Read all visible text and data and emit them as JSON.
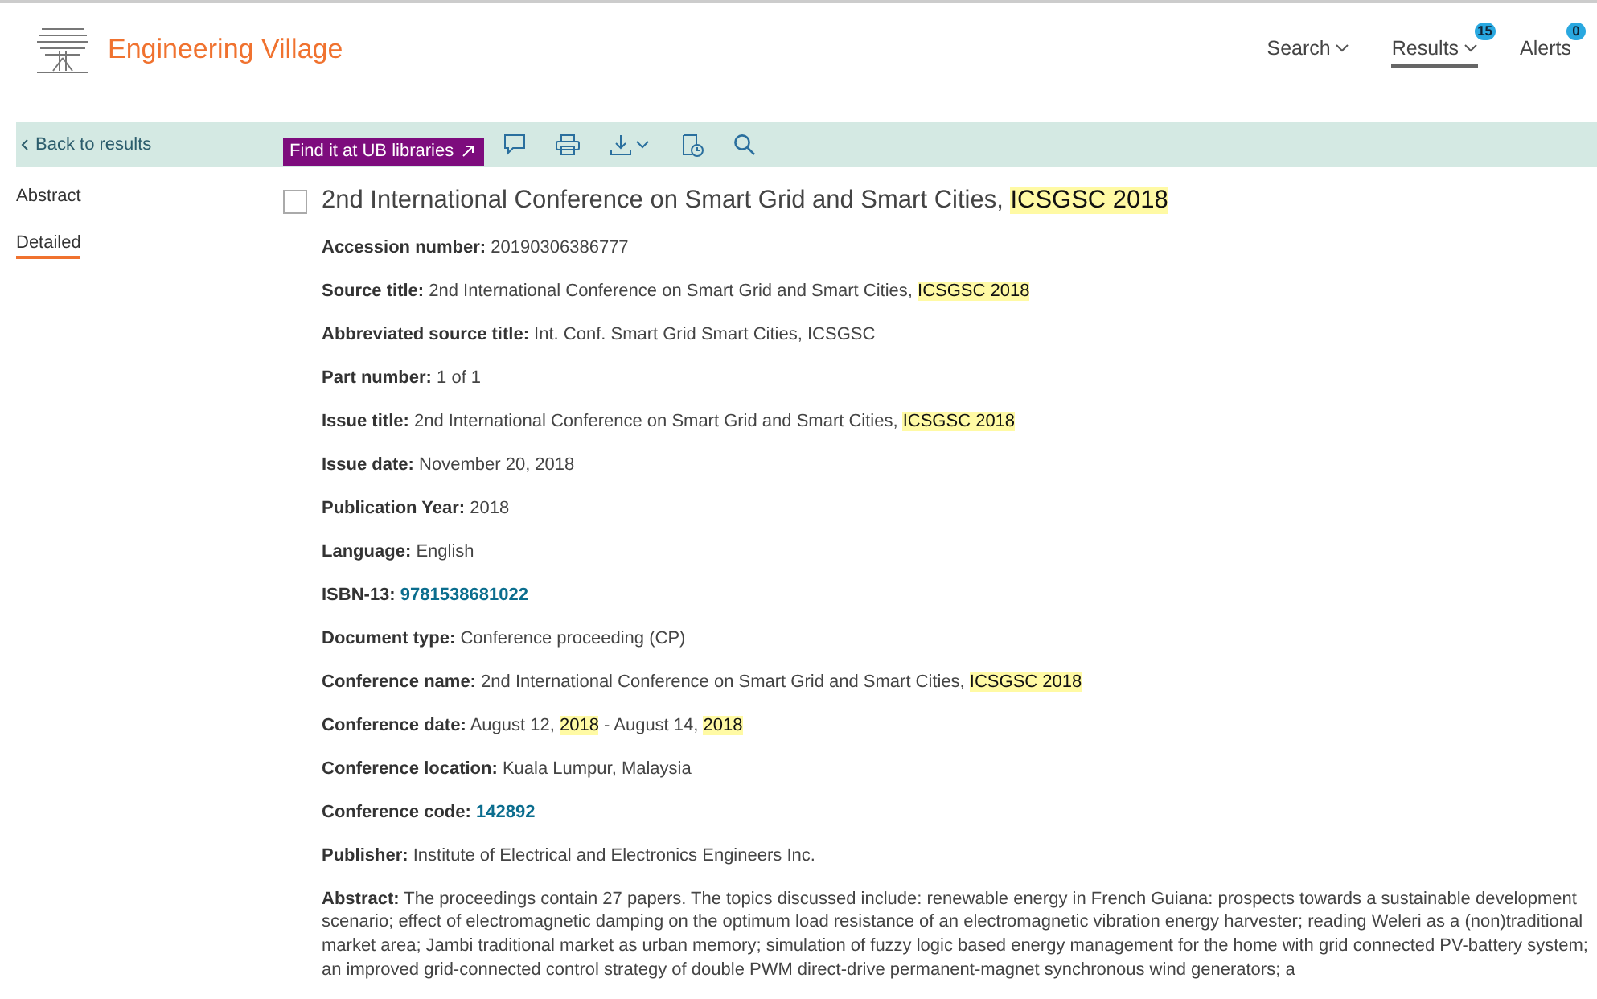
{
  "header": {
    "brand": "Engineering Village",
    "nav": [
      {
        "label": "Search",
        "dropdown": true,
        "selected": false
      },
      {
        "label": "Results",
        "dropdown": true,
        "selected": true,
        "badge": "15"
      },
      {
        "label": "Alerts",
        "dropdown": false,
        "selected": false,
        "badge": "0"
      }
    ]
  },
  "toolbar": {
    "back": "Back to results",
    "find_button": "Find it at UB libraries"
  },
  "sidebar": {
    "items": [
      {
        "label": "Abstract",
        "selected": false
      },
      {
        "label": "Detailed",
        "selected": true
      }
    ]
  },
  "record": {
    "checked": false,
    "title": [
      {
        "text": "2nd International Conference on Smart Grid and Smart Cities, ",
        "highlighted": false
      },
      {
        "text": "ICSGSC 2018",
        "highlighted": true
      }
    ],
    "fields": [
      {
        "label": "Accession number:",
        "kind": "text",
        "value": [
          {
            "text": "20190306386777",
            "highlighted": false
          }
        ]
      },
      {
        "label": "Source title:",
        "kind": "text",
        "value": [
          {
            "text": "2nd International Conference on Smart Grid and Smart Cities, ",
            "highlighted": false
          },
          {
            "text": "ICSGSC 2018",
            "highlighted": true
          }
        ]
      },
      {
        "label": "Abbreviated source title:",
        "kind": "text",
        "value": [
          {
            "text": "Int. Conf. Smart Grid Smart Cities, ICSGSC",
            "highlighted": false
          }
        ]
      },
      {
        "label": "Part number:",
        "kind": "text",
        "value": [
          {
            "text": "1 of 1",
            "highlighted": false
          }
        ]
      },
      {
        "label": "Issue title:",
        "kind": "text",
        "value": [
          {
            "text": "2nd International Conference on Smart Grid and Smart Cities, ",
            "highlighted": false
          },
          {
            "text": "ICSGSC 2018",
            "highlighted": true
          }
        ]
      },
      {
        "label": "Issue date:",
        "kind": "text",
        "value": [
          {
            "text": "November 20, 2018",
            "highlighted": false
          }
        ]
      },
      {
        "label": "Publication Year:",
        "kind": "text",
        "value": [
          {
            "text": "2018",
            "highlighted": false
          }
        ]
      },
      {
        "label": "Language:",
        "kind": "text",
        "value": [
          {
            "text": "English",
            "highlighted": false
          }
        ]
      },
      {
        "label": "ISBN-13:",
        "kind": "link",
        "value": [
          {
            "text": "9781538681022",
            "highlighted": false
          }
        ]
      },
      {
        "label": "Document type:",
        "kind": "text",
        "value": [
          {
            "text": "Conference proceeding (CP)",
            "highlighted": false
          }
        ]
      },
      {
        "label": "Conference name:",
        "kind": "text",
        "value": [
          {
            "text": "2nd International Conference on Smart Grid and Smart Cities, ",
            "highlighted": false
          },
          {
            "text": "ICSGSC 2018",
            "highlighted": true
          }
        ]
      },
      {
        "label": "Conference date:",
        "kind": "text",
        "value": [
          {
            "text": "August 12, ",
            "highlighted": false
          },
          {
            "text": "2018",
            "highlighted": true
          },
          {
            "text": " - August 14, ",
            "highlighted": false
          },
          {
            "text": "2018",
            "highlighted": true
          }
        ]
      },
      {
        "label": "Conference location:",
        "kind": "text",
        "value": [
          {
            "text": "Kuala Lumpur, Malaysia",
            "highlighted": false
          }
        ]
      },
      {
        "label": "Conference code:",
        "kind": "link",
        "value": [
          {
            "text": "142892",
            "highlighted": false
          }
        ]
      },
      {
        "label": "Publisher:",
        "kind": "text",
        "value": [
          {
            "text": "Institute of Electrical and Electronics Engineers Inc.",
            "highlighted": false
          }
        ]
      },
      {
        "label": "Abstract:",
        "kind": "text",
        "value": [
          {
            "text": "The proceedings contain 27 papers. The topics discussed include: renewable energy in French Guiana: prospects towards a sustainable development scenario; effect of electromagnetic damping on the optimum load resistance of an electromagnetic vibration energy harvester; reading Weleri as a (non)traditional market area; Jambi traditional market as urban memory; simulation of fuzzy logic based energy management for the home with grid connected PV-battery system; an improved grid-connected control strategy of double PWM direct-drive permanent-magnet synchronous wind generators; a",
            "highlighted": false
          }
        ]
      }
    ]
  }
}
